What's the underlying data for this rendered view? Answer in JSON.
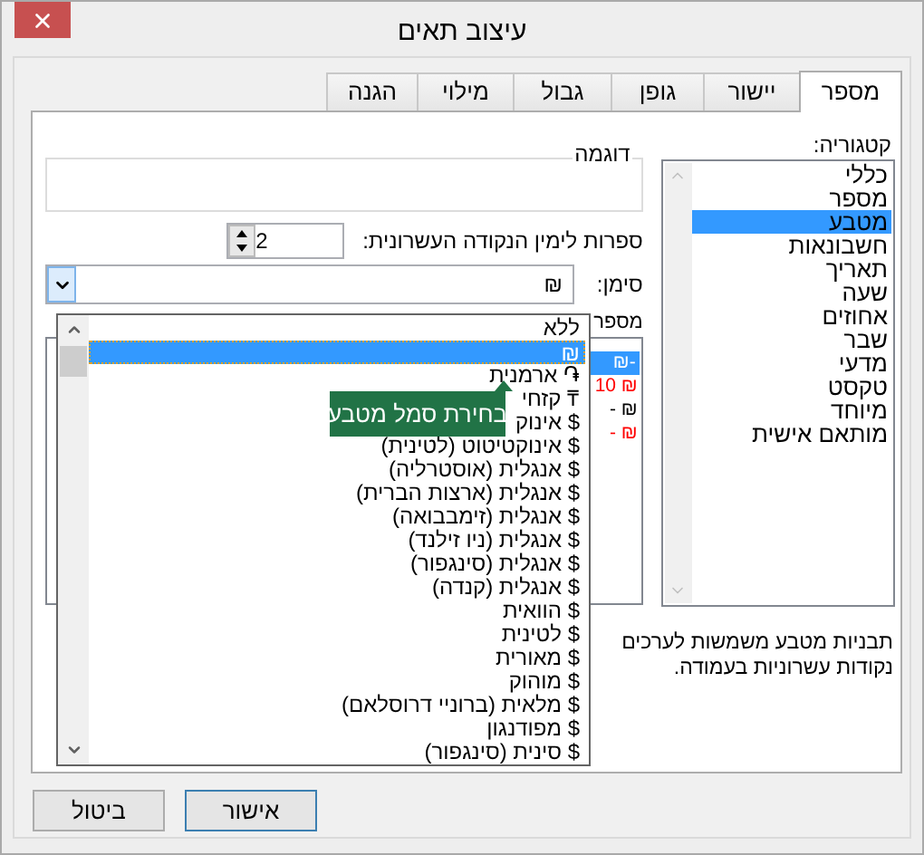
{
  "window": {
    "title": "עיצוב תאים"
  },
  "tabs": [
    {
      "label": "מספר",
      "selected": true
    },
    {
      "label": "יישור",
      "selected": false
    },
    {
      "label": "גופן",
      "selected": false
    },
    {
      "label": "גבול",
      "selected": false
    },
    {
      "label": "מילוי",
      "selected": false
    },
    {
      "label": "הגנה",
      "selected": false
    }
  ],
  "category": {
    "label": "קטגוריה:",
    "items": [
      {
        "label": "כללי",
        "selected": false
      },
      {
        "label": "מספר",
        "selected": false
      },
      {
        "label": "מטבע",
        "selected": true
      },
      {
        "label": "חשבונאות",
        "selected": false
      },
      {
        "label": "תאריך",
        "selected": false
      },
      {
        "label": "שעה",
        "selected": false
      },
      {
        "label": "אחוזים",
        "selected": false
      },
      {
        "label": "שבר",
        "selected": false
      },
      {
        "label": "מדעי",
        "selected": false
      },
      {
        "label": "טקסט",
        "selected": false
      },
      {
        "label": "מיוחד",
        "selected": false
      },
      {
        "label": "מותאם אישית",
        "selected": false
      }
    ]
  },
  "sample": {
    "label": "דוגמה"
  },
  "decimal_places": {
    "label": "ספרות לימין הנקודה העשרונית:",
    "value": "2"
  },
  "symbol": {
    "label": "סימן:",
    "value": "₪",
    "expanded": true
  },
  "negative_numbers": {
    "label": "מספר",
    "items": [
      {
        "text": "₪-",
        "selected": true
      },
      {
        "text": "10 ₪",
        "color": "#ff0000",
        "selected": false
      },
      {
        "text": "- ₪",
        "color": "#000000",
        "selected": false
      },
      {
        "text": "- ₪",
        "color": "#ff0000",
        "selected": false
      }
    ]
  },
  "symbol_dropdown": {
    "tooltip": "בחירת סמל מטבע",
    "items": [
      {
        "label": "ללא",
        "selected": false
      },
      {
        "label": "₪",
        "selected": true
      },
      {
        "label": "֏ ארמנית",
        "selected": false
      },
      {
        "label": "₸ קזחי",
        "selected": false
      },
      {
        "label": "$ אינוק",
        "selected": false
      },
      {
        "label": "$ אינוקטיטוט (לטינית)",
        "selected": false
      },
      {
        "label": "$ אנגלית (אוסטרליה)",
        "selected": false
      },
      {
        "label": "$ אנגלית (ארצות הברית)",
        "selected": false
      },
      {
        "label": "$ אנגלית (זימבבואה)",
        "selected": false
      },
      {
        "label": "$ אנגלית (ניו זילנד)",
        "selected": false
      },
      {
        "label": "$ אנגלית (סינגפור)",
        "selected": false
      },
      {
        "label": "$ אנגלית (קנדה)",
        "selected": false
      },
      {
        "label": "$ הוואית",
        "selected": false
      },
      {
        "label": "$ לטינית",
        "selected": false
      },
      {
        "label": "$ מאורית",
        "selected": false
      },
      {
        "label": "$ מוהוק",
        "selected": false
      },
      {
        "label": "$ מלאית (ברוניי דרוסלאם)",
        "selected": false
      },
      {
        "label": "$ מפודנגון",
        "selected": false
      },
      {
        "label": "$ סינית (סינגפור)",
        "selected": false
      }
    ]
  },
  "description": [
    "תבניות מטבע משמשות לערכים",
    "נקודות עשרוניות בעמודה."
  ],
  "buttons": [
    {
      "label": "אישור",
      "default": true
    },
    {
      "label": "ביטול",
      "default": false
    }
  ]
}
